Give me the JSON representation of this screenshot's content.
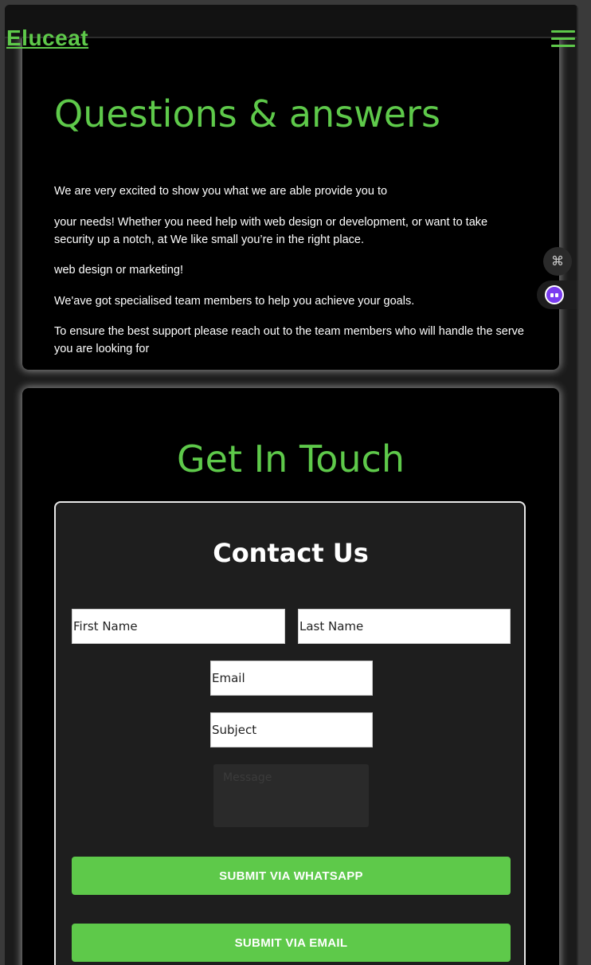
{
  "header": {
    "logo": "Eluceat",
    "menu_icon": "hamburger-menu-icon",
    "accent_color": "#5ec94a"
  },
  "qa": {
    "title": "Questions & answers",
    "paragraphs": [
      "We are very excited to show you what we are able provide you to",
      "your needs! Whether you need help with web design or development, or want to take security up a notch, at We like small you’re in the right place.",
      "web design or marketing!",
      "We'ave got specialised team members to help you achieve your goals.",
      "To ensure the best support please reach out to the team members who will handle the serve you are looking for"
    ]
  },
  "contact": {
    "section_title": "Get In Touch",
    "form_title": "Contact Us",
    "first_name_placeholder": "First Name",
    "last_name_placeholder": "Last Name",
    "email_placeholder": "Email",
    "subject_placeholder": "Subject",
    "message_placeholder": "Message",
    "whatsapp_button": "SUBMIT VIA WHATSAPP",
    "email_button": "SUBMIT VIA EMAIL"
  },
  "side_widgets": {
    "shortcut_icon": "command-icon",
    "assistant_icon": "assistant-bot-icon"
  }
}
